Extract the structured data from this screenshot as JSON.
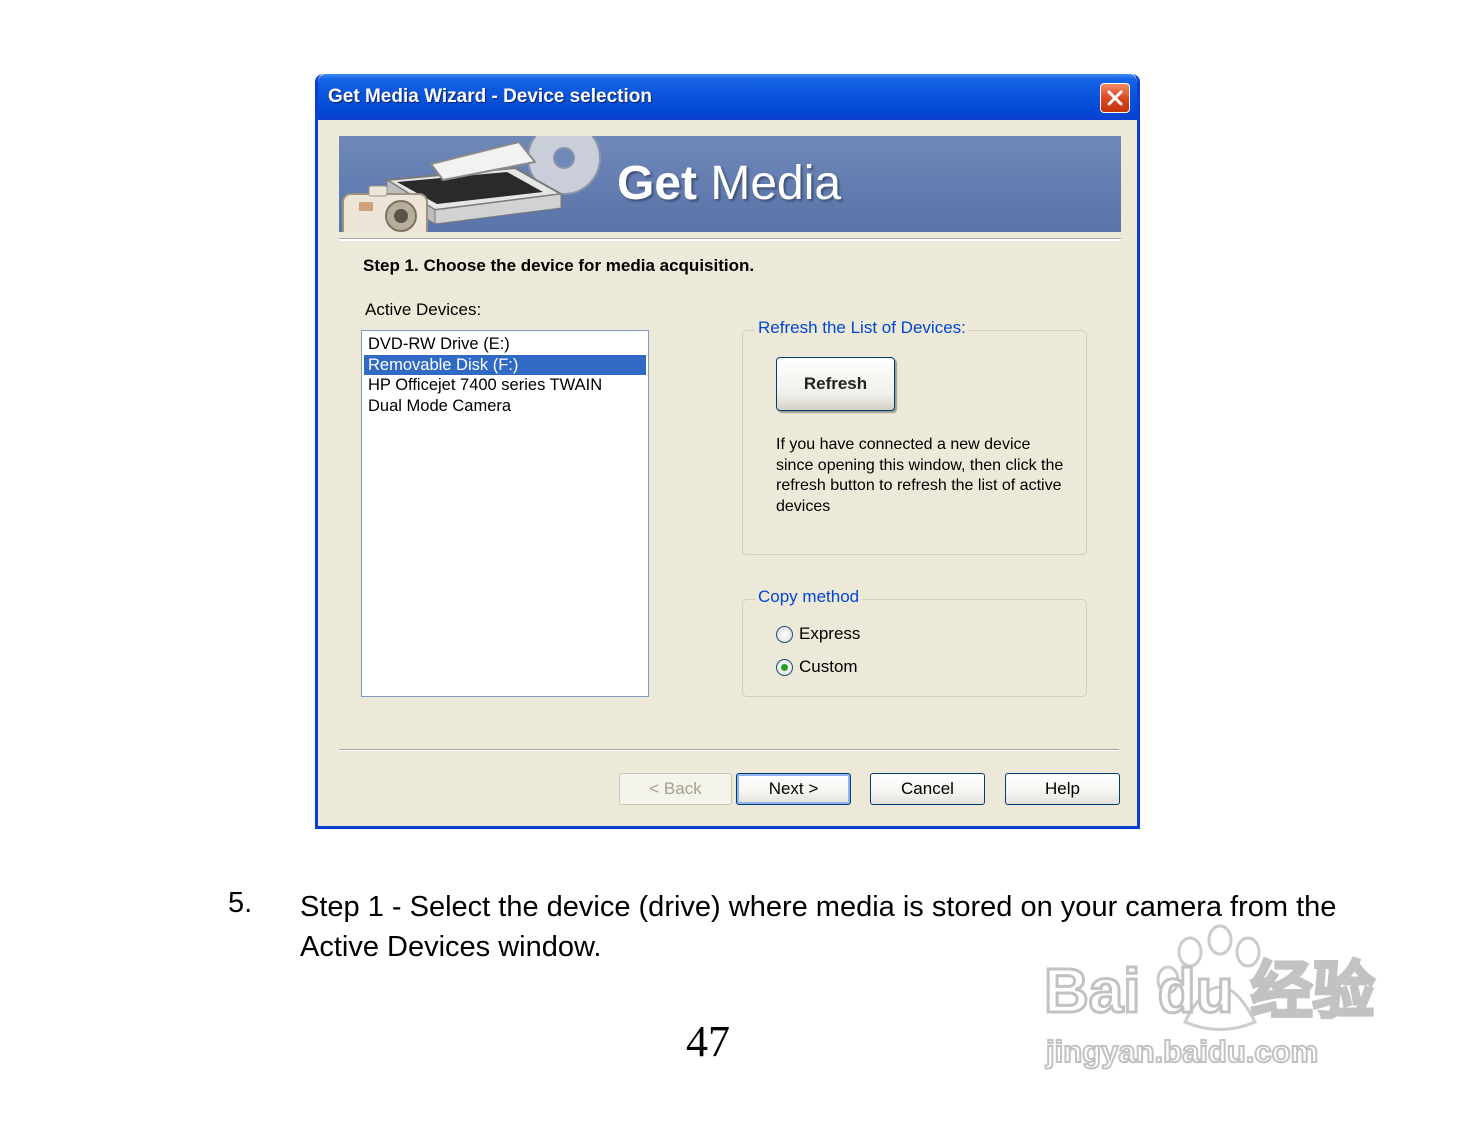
{
  "dialog": {
    "title": "Get Media Wizard - Device selection",
    "banner": {
      "title_bold": "Get",
      "title_regular": " Media"
    },
    "step": "Step 1. Choose the device for media acquisition.",
    "active_label": "Active Devices:",
    "devices": [
      {
        "label": "DVD-RW Drive (E:)"
      },
      {
        "label": "Removable Disk (F:)"
      },
      {
        "label": "HP Officejet 7400 series TWAIN"
      },
      {
        "label": "Dual Mode Camera"
      }
    ],
    "selected_device": "Removable Disk (F:)",
    "refresh_group": {
      "legend": "Refresh the List of Devices:",
      "button": "Refresh",
      "help": "If you have connected a new device since opening this window, then click the refresh button to refresh the list of active devices"
    },
    "copy_group": {
      "legend": "Copy method",
      "options": [
        {
          "label": "Express",
          "checked": false
        },
        {
          "label": "Custom",
          "checked": true
        }
      ]
    },
    "buttons": {
      "back": "< Back",
      "next": "Next >",
      "cancel": "Cancel",
      "help": "Help"
    }
  },
  "instruction": {
    "number": "5.",
    "text": "Step 1 - Select the device (drive) where media is stored on your camera from the Active Devices window."
  },
  "page_number": "47",
  "watermark": {
    "brand": "Bai du 经验",
    "url": "jingyan.baidu.com"
  },
  "colors": {
    "title_bar": "#0a55dc",
    "selection": "#316ac5",
    "group_legend": "#0046d5",
    "dialog_face": "#ece9d8"
  }
}
